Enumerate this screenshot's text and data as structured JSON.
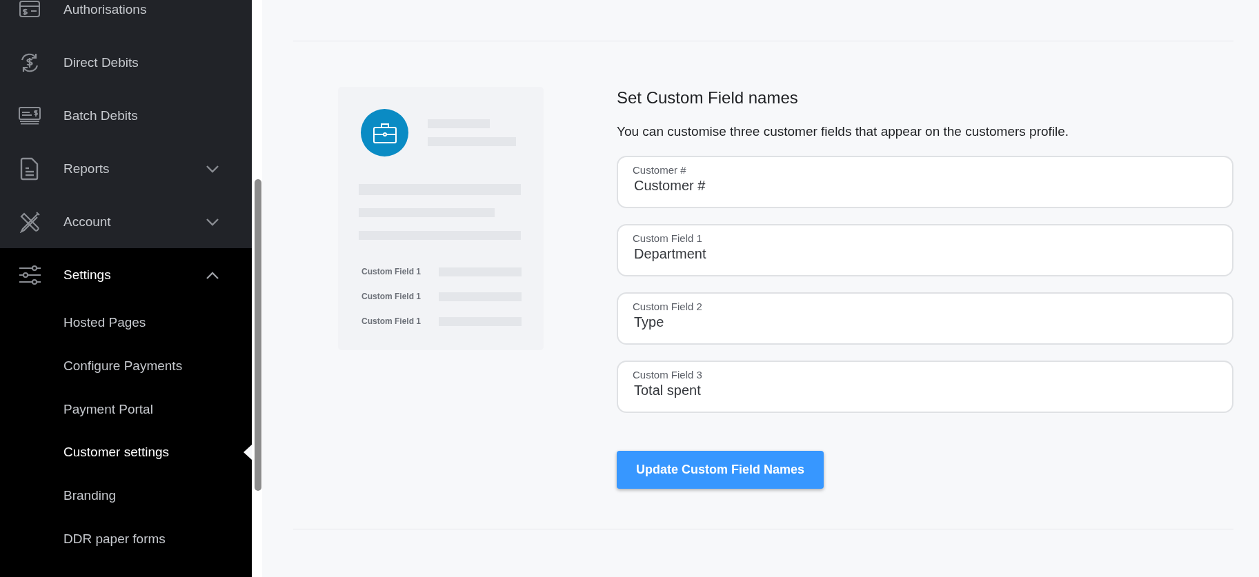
{
  "sidebar": {
    "items": [
      {
        "label": "Authorisations",
        "expandable": false,
        "expanded": false
      },
      {
        "label": "Direct Debits",
        "expandable": false,
        "expanded": false
      },
      {
        "label": "Batch Debits",
        "expandable": false,
        "expanded": false
      },
      {
        "label": "Reports",
        "expandable": true,
        "expanded": false
      },
      {
        "label": "Account",
        "expandable": true,
        "expanded": false
      },
      {
        "label": "Settings",
        "expandable": true,
        "expanded": true,
        "children": [
          {
            "label": "Hosted Pages",
            "selected": false
          },
          {
            "label": "Configure Payments",
            "selected": false
          },
          {
            "label": "Payment Portal",
            "selected": false
          },
          {
            "label": "Customer settings",
            "selected": true
          },
          {
            "label": "Branding",
            "selected": false
          },
          {
            "label": "DDR paper forms",
            "selected": false
          }
        ]
      }
    ]
  },
  "preview": {
    "field_labels": [
      "Custom Field 1",
      "Custom Field 1",
      "Custom Field 1"
    ]
  },
  "form": {
    "title": "Set Custom Field names",
    "description": "You can customise three customer fields that appear on the customers profile.",
    "fields": [
      {
        "label": "Customer #",
        "value": "Customer #"
      },
      {
        "label": "Custom Field 1",
        "value": "Department"
      },
      {
        "label": "Custom Field 2",
        "value": "Type"
      },
      {
        "label": "Custom Field 3",
        "value": "Total spent"
      }
    ],
    "submit": "Update Custom Field Names"
  }
}
